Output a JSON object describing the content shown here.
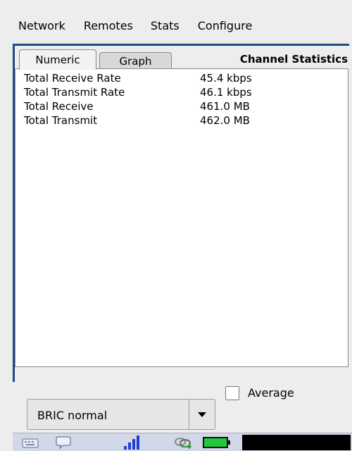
{
  "menu": {
    "items": [
      "Network",
      "Remotes",
      "Stats",
      "Configure"
    ]
  },
  "panel": {
    "tabs": [
      "Numeric",
      "Graph"
    ],
    "active_tab": "Numeric",
    "title": "Channel Statistics",
    "stats": [
      {
        "label": "Total Receive Rate",
        "value": "45.4 kbps"
      },
      {
        "label": "Total Transmit Rate",
        "value": "46.1 kbps"
      },
      {
        "label": "Total Receive",
        "value": "461.0 MB"
      },
      {
        "label": "Total Transmit",
        "value": "462.0 MB"
      }
    ]
  },
  "controls": {
    "mode_select": "BRIC normal",
    "average_label": "Average",
    "average_checked": false
  },
  "taskbar": {
    "icons": [
      "keyboard-icon",
      "chat-bubble-icon",
      "signal-bars-icon",
      "network-link-icon",
      "battery-icon"
    ],
    "colors": {
      "signal": "#1f3fd0",
      "battery": "#22c93a",
      "link": "#2e9c2e"
    }
  }
}
